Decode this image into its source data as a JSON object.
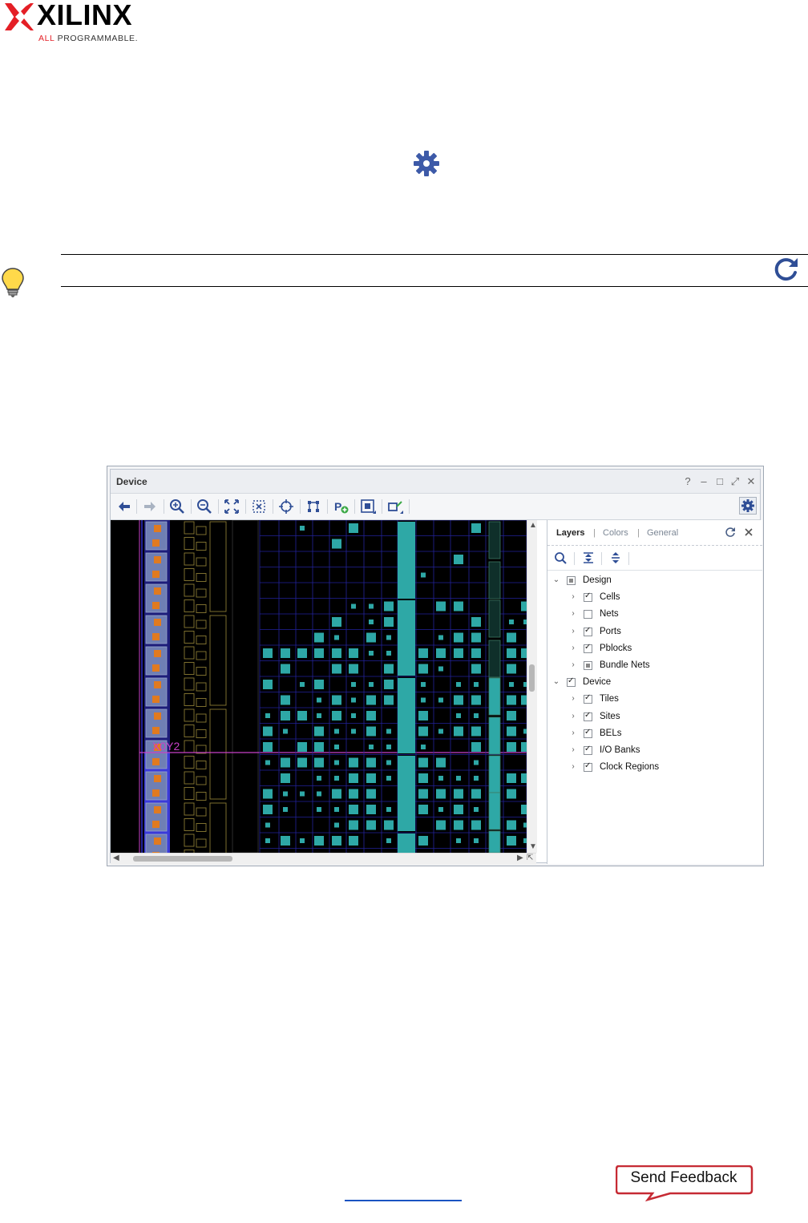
{
  "logo": {
    "brand": "XILINX",
    "tagline_prefix": "ALL",
    "tagline_rest": " PROGRAMMABLE.",
    "colors": {
      "mark": "#e41f26",
      "text": "#000000"
    }
  },
  "inline_icons": {
    "gear": "gear-icon",
    "tip": "lightbulb-icon",
    "refresh": "refresh-icon"
  },
  "device_window": {
    "title": "Device",
    "title_controls": [
      "?",
      "–",
      "□",
      "⤢",
      "✕"
    ],
    "toolbar_icons": [
      "back-arrow-icon",
      "forward-arrow-icon",
      "zoom-in-icon",
      "zoom-out-icon",
      "fit-icon",
      "zoom-selection-icon",
      "autofit-selection-icon",
      "routing-resources-icon",
      "draw-pblock-icon",
      "show-cell-connectivity-icon",
      "show-tile-icon",
      "settings-icon"
    ],
    "canvas": {
      "clock_region_label": "X0Y2",
      "colors": {
        "background": "#000000",
        "grid": "#22229a",
        "site": "#2ea8a6",
        "cell": "#e07a20",
        "region": "#c840c8",
        "column": "#3a3ad8"
      }
    },
    "layers_panel": {
      "tabs": [
        "Layers",
        "Colors",
        "General"
      ],
      "active_tab": "Layers",
      "tree": [
        {
          "label": "Design",
          "level": 0,
          "state": "partial",
          "expanded": true
        },
        {
          "label": "Cells",
          "level": 1,
          "state": "checked",
          "expanded": false
        },
        {
          "label": "Nets",
          "level": 1,
          "state": "unchecked",
          "expanded": false
        },
        {
          "label": "Ports",
          "level": 1,
          "state": "checked",
          "expanded": false
        },
        {
          "label": "Pblocks",
          "level": 1,
          "state": "checked",
          "expanded": false
        },
        {
          "label": "Bundle Nets",
          "level": 1,
          "state": "partial",
          "expanded": false
        },
        {
          "label": "Device",
          "level": 0,
          "state": "checked",
          "expanded": true
        },
        {
          "label": "Tiles",
          "level": 1,
          "state": "checked",
          "expanded": false
        },
        {
          "label": "Sites",
          "level": 1,
          "state": "checked",
          "expanded": false
        },
        {
          "label": "BELs",
          "level": 1,
          "state": "checked",
          "expanded": false
        },
        {
          "label": "I/O Banks",
          "level": 1,
          "state": "checked",
          "expanded": false
        },
        {
          "label": "Clock Regions",
          "level": 1,
          "state": "checked",
          "expanded": false
        }
      ]
    }
  },
  "feedback": {
    "label": "Send Feedback"
  }
}
